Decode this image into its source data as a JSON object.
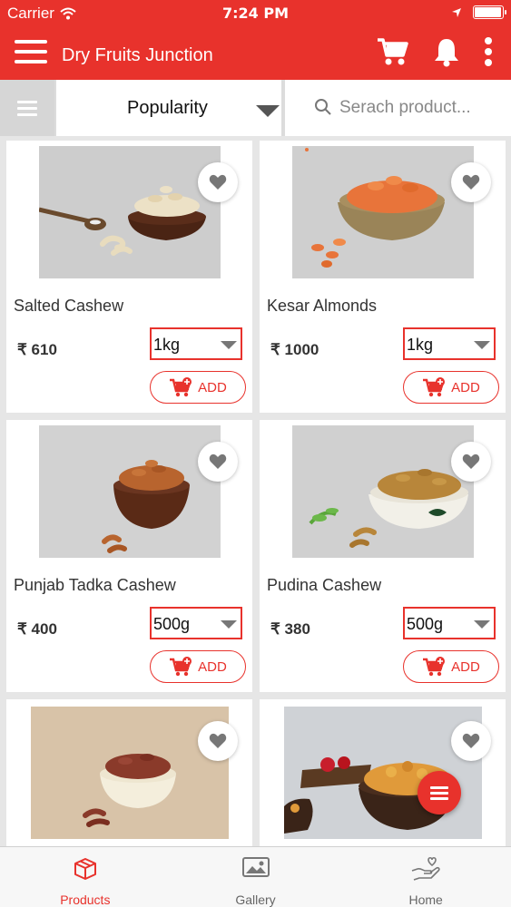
{
  "status_bar": {
    "carrier": "Carrier",
    "time": "7:24 PM"
  },
  "app_bar": {
    "title": "Dry Fruits Junction"
  },
  "filter_bar": {
    "sort_value": "Popularity",
    "search_placeholder": "Serach product..."
  },
  "currency_symbol": "₹",
  "add_label": "ADD",
  "products": [
    {
      "name": "Salted Cashew",
      "price": "₹ 610",
      "weight": "1kg"
    },
    {
      "name": "Kesar Almonds",
      "price": "₹ 1000",
      "weight": "1kg"
    },
    {
      "name": "Punjab Tadka Cashew",
      "price": "₹ 400",
      "weight": "500g"
    },
    {
      "name": "Pudina Cashew",
      "price": "₹ 380",
      "weight": "500g"
    }
  ],
  "tabs": [
    {
      "label": "Products",
      "active": true
    },
    {
      "label": "Gallery",
      "active": false
    },
    {
      "label": "Home",
      "active": false
    }
  ],
  "colors": {
    "brand_red": "#e8322c",
    "background": "#e6e6e6"
  }
}
